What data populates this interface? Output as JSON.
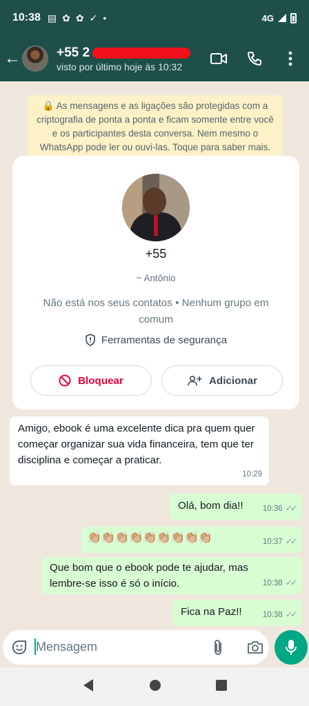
{
  "status_bar": {
    "time": "10:38",
    "network": "4G"
  },
  "header": {
    "contact_number": "+55 2",
    "last_seen": "visto por último hoje às 10:32"
  },
  "encryption_notice": "🔒 As mensagens e as ligações são protegidas com a criptografia de ponta a ponta e ficam somente entre você e os participantes desta conversa. Nem mesmo o WhatsApp pode ler ou ouvi-las. Toque para saber mais.",
  "profile_card": {
    "number": "+55",
    "name": "~ Antônio",
    "context": "Não está nos seus contatos • Nenhum grupo em comum",
    "security_label": "Ferramentas de segurança",
    "block_label": "Bloquear",
    "add_label": "Adicionar"
  },
  "messages": [
    {
      "direction": "in",
      "text": "Amigo, ebook é uma excelente dica pra quem quer começar organizar sua vida financeira, tem que ter disciplina e começar a praticar.",
      "time": "10:29"
    },
    {
      "direction": "out",
      "text": "Olá, bom dia!!",
      "time": "10:36"
    },
    {
      "direction": "out",
      "text": "👏🏼👏🏼👏🏼👏🏼👏🏼👏🏼👏🏼👏🏼👏🏼",
      "time": "10:37"
    },
    {
      "direction": "out",
      "text": "Que bom que o ebook pode te ajudar, mas lembre-se isso é só o início.",
      "time": "10:38"
    },
    {
      "direction": "out",
      "text": "Fica na Paz!!",
      "time": "10:38"
    }
  ],
  "composer": {
    "placeholder": "Mensagem"
  },
  "colors": {
    "header": "#1f4f4b",
    "accent": "#00a884",
    "outgoing": "#d9fdd3",
    "danger": "#ea0038"
  }
}
